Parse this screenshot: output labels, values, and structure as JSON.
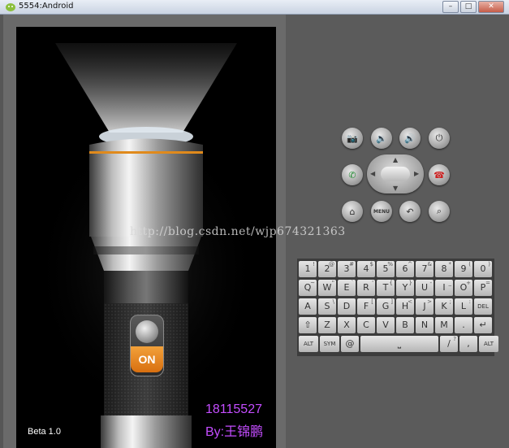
{
  "window": {
    "title": "5554:Android",
    "buttons": [
      "–",
      "□",
      "✕"
    ]
  },
  "app": {
    "switch_label": "ON",
    "version": "Beta 1.0",
    "phone": "18115527",
    "author": "By:王锦鹏"
  },
  "watermark": "http://blog.csdn.net/wjp674321363",
  "controls": {
    "row1": [
      {
        "icon": "camera-icon",
        "glyph": "📷"
      },
      {
        "icon": "volume-down-icon",
        "glyph": "🔉"
      },
      {
        "icon": "volume-up-icon",
        "glyph": "🔊"
      },
      {
        "icon": "power-icon",
        "glyph": "⏻"
      }
    ],
    "call": {
      "icon": "call-icon",
      "glyph": "✆"
    },
    "end_call": {
      "icon": "end-call-icon",
      "glyph": "☎"
    },
    "row3": [
      {
        "icon": "home-icon",
        "glyph": "⌂"
      },
      {
        "icon": "menu-icon",
        "glyph": "MENU"
      },
      {
        "icon": "back-icon",
        "glyph": "↶"
      },
      {
        "icon": "search-icon",
        "glyph": "⌕"
      }
    ]
  },
  "keyboard": {
    "row1": [
      [
        "1",
        "!"
      ],
      [
        "2",
        "@"
      ],
      [
        "3",
        "#"
      ],
      [
        "4",
        "$"
      ],
      [
        "5",
        "%"
      ],
      [
        "6",
        "^"
      ],
      [
        "7",
        "&"
      ],
      [
        "8",
        "*"
      ],
      [
        "9",
        "("
      ],
      [
        "0",
        ")"
      ]
    ],
    "row2": [
      [
        "Q",
        "~"
      ],
      [
        "W",
        "\""
      ],
      [
        "E",
        "`"
      ],
      [
        "R",
        "'"
      ],
      [
        "T",
        "{"
      ],
      [
        "Y",
        "}"
      ],
      [
        "U",
        "-"
      ],
      [
        "I",
        "_"
      ],
      [
        "O",
        "+"
      ],
      [
        "P",
        "="
      ]
    ],
    "row3": [
      [
        "A",
        ""
      ],
      [
        "S",
        "\\"
      ],
      [
        "D",
        ""
      ],
      [
        "F",
        "["
      ],
      [
        "G",
        "]"
      ],
      [
        "H",
        "<"
      ],
      [
        "J",
        ">"
      ],
      [
        "K",
        ";"
      ],
      [
        "L",
        ":"
      ],
      [
        "DEL",
        ""
      ]
    ],
    "row4": [
      [
        "⇧",
        ""
      ],
      [
        "Z",
        ""
      ],
      [
        "X",
        ""
      ],
      [
        "C",
        ""
      ],
      [
        "V",
        ""
      ],
      [
        "B",
        ""
      ],
      [
        "N",
        ""
      ],
      [
        "M",
        ""
      ],
      [
        ".",
        ""
      ],
      [
        "↵",
        ""
      ]
    ],
    "row5": [
      [
        "ALT",
        ""
      ],
      [
        "SYM",
        ""
      ],
      [
        "@",
        ""
      ],
      [
        "⎵",
        ""
      ],
      [
        "/",
        "?"
      ],
      [
        ",",
        ""
      ],
      [
        "ALT",
        ""
      ]
    ]
  }
}
